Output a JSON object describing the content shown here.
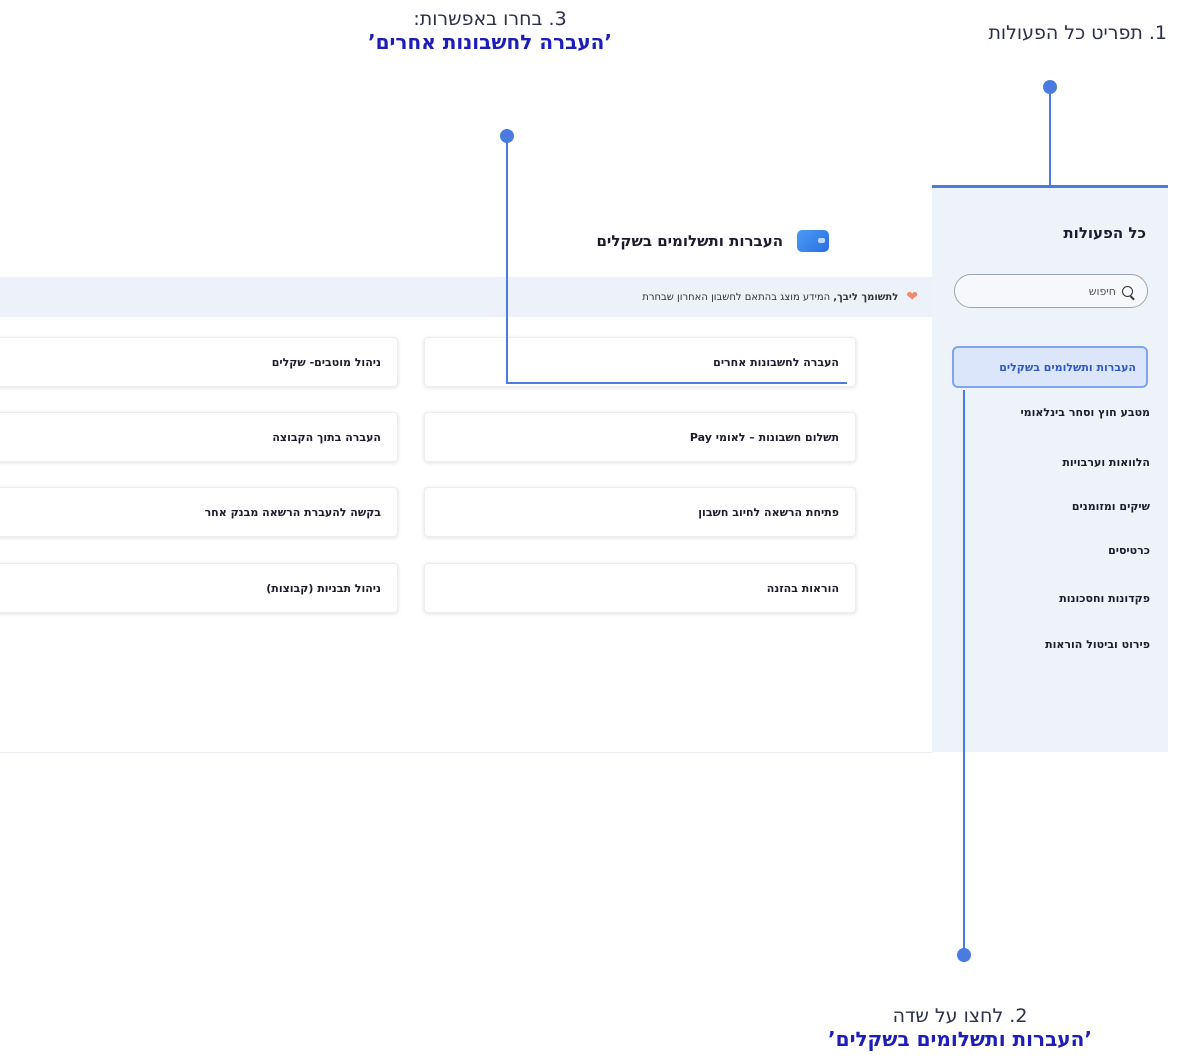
{
  "annotations": {
    "step1": "1. תפריט כל הפעולות",
    "step2_title": "2. לחצו על שדה",
    "step2_target": "’העברות ותשלומים בשקלים’",
    "step3_title": "3. בחרו באפשרות:",
    "step3_target": "’העברה לחשבונות אחרים’"
  },
  "sidebar": {
    "heading": "כל הפעולות",
    "search_placeholder": "חיפוש",
    "items": [
      {
        "label": "העברות ותשלומים בשקלים",
        "active": true
      },
      {
        "label": "מטבע חוץ וסחר בינלאומי"
      },
      {
        "label": "הלוואות וערבויות"
      },
      {
        "label": "שיקים ומזומנים"
      },
      {
        "label": "כרטיסים"
      },
      {
        "label": "פקדונות וחסכונות"
      },
      {
        "label": "פירוט וביטול הוראות"
      }
    ]
  },
  "main": {
    "title": "העברות ותשלומים בשקלים",
    "notice_bold": "לתשומך ליבך,",
    "notice_text": "המידע מוצג בהתאם לחשבון האחרון שבחרת",
    "cards_right": [
      "העברה לחשבונות אחרים",
      "תשלום חשבונות – לאומי Pay",
      "פתיחת הרשאה לחיוב חשבון",
      "הוראות בהזנה"
    ],
    "cards_left": [
      "ניהול מוטבים- שקלים",
      "העברה בתוך הקבוצה",
      "בקשה להעברת הרשאה מבנק אחר",
      "ניהול תבניות (קבוצות)"
    ]
  },
  "colors": {
    "accent": "#4a7be0",
    "active_item_text": "#2f57c6",
    "annotation_bold": "#1d1db8"
  }
}
